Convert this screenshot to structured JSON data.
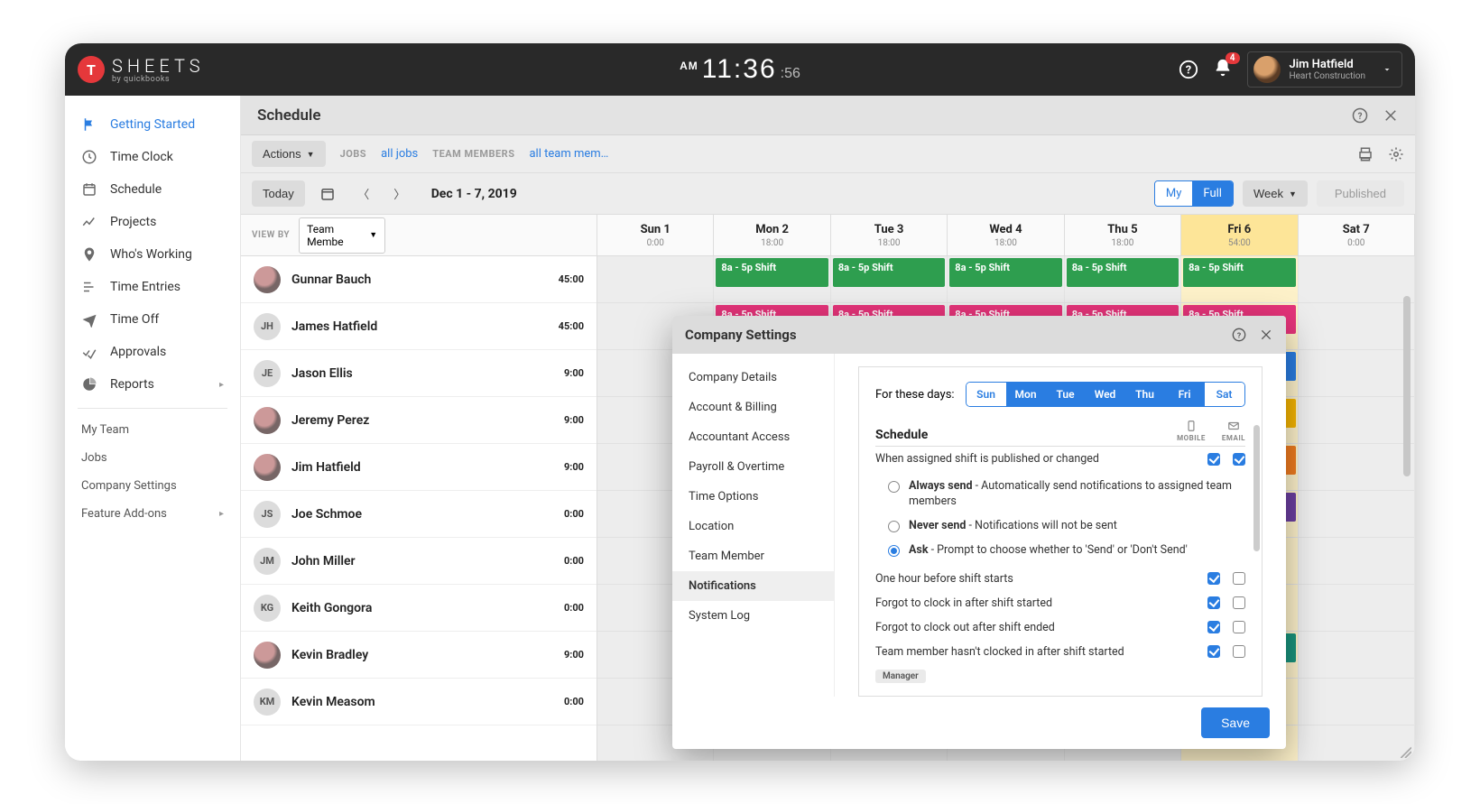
{
  "brand": {
    "letter": "T",
    "name": "SHEETS",
    "sub": "by quickbooks"
  },
  "clock": {
    "ampm": "AM",
    "hm": "11:36",
    "sec": ":56"
  },
  "notif_count": "4",
  "user": {
    "name": "Jim Hatfield",
    "org": "Heart Construction"
  },
  "sidebar": {
    "primary": [
      "Getting Started",
      "Time Clock",
      "Schedule",
      "Projects",
      "Who's Working",
      "Time Entries",
      "Time Off",
      "Approvals",
      "Reports"
    ],
    "secondary": [
      "My Team",
      "Jobs",
      "Company Settings",
      "Feature Add-ons"
    ]
  },
  "page": {
    "title": "Schedule"
  },
  "toolbar1": {
    "actions": "Actions",
    "jobs_label": "JOBS",
    "jobs_value": "all jobs",
    "tm_label": "TEAM MEMBERS",
    "tm_value": "all team mem…"
  },
  "toolbar2": {
    "today": "Today",
    "range": "Dec 1 - 7, 2019",
    "seg_my": "My",
    "seg_full": "Full",
    "view": "Week",
    "published": "Published"
  },
  "viewby": {
    "label": "VIEW BY",
    "value": "Team Membe"
  },
  "days": [
    {
      "name": "Sun 1",
      "hours": "0:00",
      "key": "sun"
    },
    {
      "name": "Mon 2",
      "hours": "18:00",
      "key": "mon"
    },
    {
      "name": "Tue 3",
      "hours": "18:00",
      "key": "tue"
    },
    {
      "name": "Wed 4",
      "hours": "18:00",
      "key": "wed"
    },
    {
      "name": "Thu 5",
      "hours": "18:00",
      "key": "thu"
    },
    {
      "name": "Fri 6",
      "hours": "54:00",
      "key": "fri"
    },
    {
      "name": "Sat 7",
      "hours": "0:00",
      "key": "sat"
    }
  ],
  "members": [
    {
      "name": "Gunnar Bauch",
      "hours": "45:00",
      "initials": "",
      "photo": true
    },
    {
      "name": "James Hatfield",
      "hours": "45:00",
      "initials": "JH",
      "photo": false
    },
    {
      "name": "Jason Ellis",
      "hours": "9:00",
      "initials": "JE",
      "photo": false
    },
    {
      "name": "Jeremy Perez",
      "hours": "9:00",
      "initials": "",
      "photo": true
    },
    {
      "name": "Jim Hatfield",
      "hours": "9:00",
      "initials": "",
      "photo": true
    },
    {
      "name": "Joe Schmoe",
      "hours": "0:00",
      "initials": "JS",
      "photo": false
    },
    {
      "name": "John Miller",
      "hours": "0:00",
      "initials": "JM",
      "photo": false
    },
    {
      "name": "Keith Gongora",
      "hours": "0:00",
      "initials": "KG",
      "photo": false
    },
    {
      "name": "Kevin Bradley",
      "hours": "9:00",
      "initials": "",
      "photo": true
    },
    {
      "name": "Kevin Measom",
      "hours": "0:00",
      "initials": "KM",
      "photo": false
    }
  ],
  "shift_label": "8a - 5p Shift",
  "schedule": [
    {
      "mon": "green",
      "tue": "green",
      "wed": "green",
      "thu": "green",
      "fri": "green"
    },
    {
      "mon": "pink",
      "tue": "pink",
      "wed": "pink",
      "thu": "pink",
      "fri": "pink"
    },
    {
      "fri": "blue"
    },
    {
      "fri": "yellow"
    },
    {
      "fri": "orange"
    },
    {
      "fri": "purple"
    },
    {},
    {},
    {
      "fri": "teal"
    },
    {}
  ],
  "modal": {
    "title": "Company Settings",
    "side": [
      "Company Details",
      "Account & Billing",
      "Accountant Access",
      "Payroll & Overtime",
      "Time Options",
      "Location",
      "Team Member",
      "Notifications",
      "System Log"
    ],
    "active_side": 7,
    "for_days": "For these days:",
    "days": [
      "Sun",
      "Mon",
      "Tue",
      "Wed",
      "Thu",
      "Fri",
      "Sat"
    ],
    "day_states": [
      false,
      true,
      true,
      true,
      true,
      true,
      false
    ],
    "section": "Schedule",
    "col_mobile": "MOBILE",
    "col_email": "EMAIL",
    "line1": "When assigned shift is published or changed",
    "opt_always_b": "Always send",
    "opt_always_t": " - Automatically send notifications to assigned team members",
    "opt_never_b": "Never send",
    "opt_never_t": " - Notifications will not be sent",
    "opt_ask_b": "Ask",
    "opt_ask_t": " - Prompt to choose whether to 'Send' or 'Don't Send'",
    "line2": "One hour before shift starts",
    "line3": "Forgot to clock in after shift started",
    "line4": "Forgot to clock out after shift ended",
    "line5": "Team member hasn't clocked in after shift started",
    "badge": "Manager",
    "save": "Save"
  }
}
